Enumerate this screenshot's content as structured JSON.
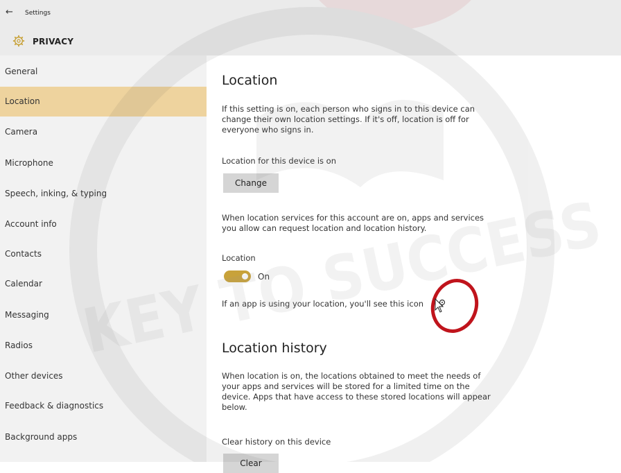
{
  "window": {
    "back_glyph": "←",
    "title": "Settings",
    "section": "PRIVACY"
  },
  "sidebar": {
    "selected_index": 1,
    "items": [
      {
        "label": "General"
      },
      {
        "label": "Location"
      },
      {
        "label": "Camera"
      },
      {
        "label": "Microphone"
      },
      {
        "label": "Speech, inking, & typing"
      },
      {
        "label": "Account info"
      },
      {
        "label": "Contacts"
      },
      {
        "label": "Calendar"
      },
      {
        "label": "Messaging"
      },
      {
        "label": "Radios"
      },
      {
        "label": "Other devices"
      },
      {
        "label": "Feedback & diagnostics"
      },
      {
        "label": "Background apps"
      }
    ]
  },
  "main": {
    "location_heading": "Location",
    "intro_text": "If this setting is on, each person who signs in to this device can change their own location settings. If it's off, location is off for everyone who signs in.",
    "device_status": "Location for this device is on",
    "change_button": "Change",
    "services_text": "When location services for this account are on, apps and services you allow can request location and location history.",
    "toggle_label": "Location",
    "toggle_state": "On",
    "toggle_on": true,
    "icon_hint_text": "If an app is using your location, you'll see this icon",
    "history_heading": "Location history",
    "history_text": "When location is on, the locations obtained to meet the needs of your apps and services will be stored for a limited time on the device. Apps that have access to these stored locations will appear below.",
    "clear_label": "Clear history on this device",
    "clear_button": "Clear"
  },
  "colors": {
    "selection": "#eed39e",
    "toggle_accent": "#c8a23a",
    "annotation_circle": "#c0141c"
  },
  "overlay": {
    "watermark_text": "KEY TO SUCCESS"
  }
}
